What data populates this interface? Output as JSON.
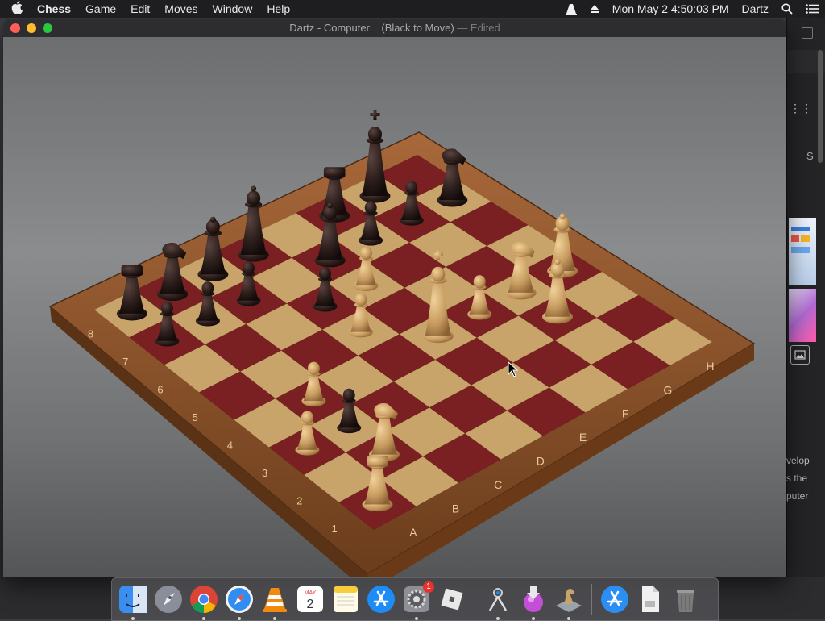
{
  "menubar": {
    "app": "Chess",
    "items": [
      "Game",
      "Edit",
      "Moves",
      "Window",
      "Help"
    ],
    "datetime": "Mon May 2  4:50:03 PM",
    "user": "Dartz"
  },
  "window": {
    "title": "Dartz - Computer",
    "status": "(Black to Move)",
    "edited": "— Edited"
  },
  "board": {
    "rank_labels": [
      "1",
      "2",
      "3",
      "4",
      "5",
      "6",
      "7",
      "8"
    ],
    "file_labels": [
      "A",
      "B",
      "C",
      "D",
      "E",
      "F",
      "G",
      "H"
    ],
    "pieces": [
      {
        "name": "black-rook-a8",
        "color": "black",
        "type": "rook",
        "square": "a8"
      },
      {
        "name": "black-knight-b8",
        "color": "black",
        "type": "knight",
        "square": "b8"
      },
      {
        "name": "black-bishop-c8",
        "color": "black",
        "type": "bishop",
        "square": "c8"
      },
      {
        "name": "black-queen-d8",
        "color": "black",
        "type": "queen",
        "square": "d8"
      },
      {
        "name": "black-rook-f8",
        "color": "black",
        "type": "rook",
        "square": "f8"
      },
      {
        "name": "black-king-g8",
        "color": "black",
        "type": "king",
        "square": "g8"
      },
      {
        "name": "black-pawn-a7",
        "color": "black",
        "type": "pawn",
        "square": "a7"
      },
      {
        "name": "black-pawn-b7",
        "color": "black",
        "type": "pawn",
        "square": "b7"
      },
      {
        "name": "black-pawn-c7",
        "color": "black",
        "type": "pawn",
        "square": "c7"
      },
      {
        "name": "black-pawn-d6",
        "color": "black",
        "type": "pawn",
        "square": "d6"
      },
      {
        "name": "black-bishop-e7",
        "color": "black",
        "type": "bishop",
        "square": "e7"
      },
      {
        "name": "black-pawn-f7",
        "color": "black",
        "type": "pawn",
        "square": "f7"
      },
      {
        "name": "black-pawn-g7",
        "color": "black",
        "type": "pawn",
        "square": "g7"
      },
      {
        "name": "black-pawn-b3",
        "color": "black",
        "type": "pawn",
        "square": "b3"
      },
      {
        "name": "black-knight-h7",
        "color": "black",
        "type": "knight",
        "square": "h7"
      },
      {
        "name": "white-rook-a1",
        "color": "white",
        "type": "rook",
        "square": "a1"
      },
      {
        "name": "white-pawn-a3",
        "color": "white",
        "type": "pawn",
        "square": "a3"
      },
      {
        "name": "white-knight-b2",
        "color": "white",
        "type": "knight",
        "square": "b2"
      },
      {
        "name": "white-pawn-b4",
        "color": "white",
        "type": "pawn",
        "square": "b4"
      },
      {
        "name": "white-pawn-d5",
        "color": "white",
        "type": "pawn",
        "square": "d5"
      },
      {
        "name": "white-pawn-e6",
        "color": "white",
        "type": "pawn",
        "square": "e6"
      },
      {
        "name": "white-king-e4",
        "color": "white",
        "type": "king",
        "square": "e4"
      },
      {
        "name": "white-bishop-g3",
        "color": "white",
        "type": "bishop",
        "square": "g3"
      },
      {
        "name": "white-pawn-f4",
        "color": "white",
        "type": "pawn",
        "square": "f4"
      },
      {
        "name": "white-bishop-h4",
        "color": "white",
        "type": "bishop",
        "square": "h4"
      },
      {
        "name": "white-knight-g4",
        "color": "white",
        "type": "knight",
        "square": "g4"
      }
    ]
  },
  "background_app": {
    "lines": [
      "velop",
      "s the",
      "puter"
    ],
    "side_letter": "S"
  },
  "dock": {
    "items": [
      {
        "name": "finder-icon",
        "running": true
      },
      {
        "name": "launchpad-icon",
        "running": false
      },
      {
        "name": "chrome-icon",
        "running": true
      },
      {
        "name": "safari-icon",
        "running": true
      },
      {
        "name": "vlc-icon",
        "running": true
      },
      {
        "name": "calendar-icon",
        "running": false,
        "month": "MAY",
        "day": "2"
      },
      {
        "name": "notes-icon",
        "running": false
      },
      {
        "name": "app-store-icon",
        "running": false
      },
      {
        "name": "system-preferences-icon",
        "running": true,
        "badge": "1"
      },
      {
        "name": "roblox-icon",
        "running": false
      },
      {
        "name": "instruments-icon",
        "running": true
      },
      {
        "name": "installer-icon",
        "running": true
      },
      {
        "name": "chess-app-icon",
        "running": true
      },
      {
        "name": "app-store-download-icon",
        "running": false
      },
      {
        "name": "document-icon",
        "running": false
      },
      {
        "name": "trash-icon",
        "running": false
      }
    ]
  },
  "colors": {
    "dark_square": "#7a1f22",
    "light_square": "#c9a46a",
    "frame": "#8a5228",
    "white_piece": "#caa168",
    "black_piece": "#2a1b18"
  }
}
